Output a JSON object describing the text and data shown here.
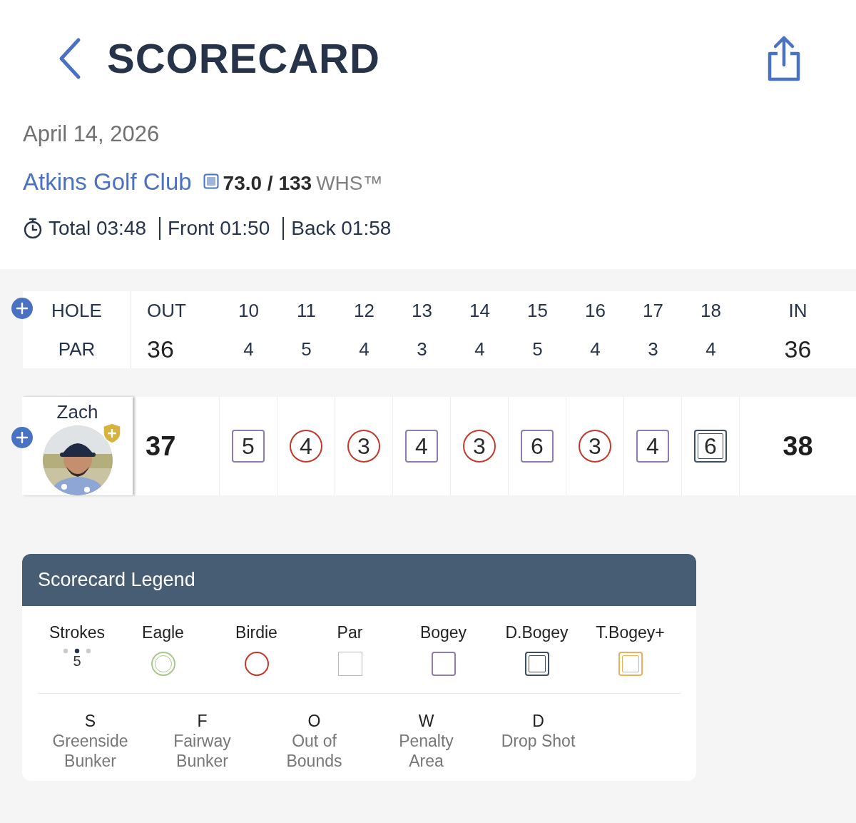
{
  "header": {
    "title": "SCORECARD"
  },
  "round": {
    "date": "April 14, 2026",
    "course": "Atkins Golf Club",
    "rating": "73.0 / 133",
    "system": "WHS™",
    "times": [
      {
        "label": "Total",
        "value": "03:48"
      },
      {
        "label": "Front",
        "value": "01:50"
      },
      {
        "label": "Back",
        "value": "01:58"
      }
    ]
  },
  "holes_row": {
    "label": "HOLE",
    "out": "OUT",
    "holes": [
      "10",
      "11",
      "12",
      "13",
      "14",
      "15",
      "16",
      "17",
      "18"
    ],
    "in": "IN"
  },
  "par_row": {
    "label": "PAR",
    "out": "36",
    "holes": [
      "4",
      "5",
      "4",
      "3",
      "4",
      "5",
      "4",
      "3",
      "4"
    ],
    "in": "36"
  },
  "player": {
    "name": "Zach",
    "out": "37",
    "in": "38",
    "scores": [
      {
        "value": "5",
        "kind": "bogey"
      },
      {
        "value": "4",
        "kind": "birdie"
      },
      {
        "value": "3",
        "kind": "birdie"
      },
      {
        "value": "4",
        "kind": "bogey"
      },
      {
        "value": "3",
        "kind": "birdie"
      },
      {
        "value": "6",
        "kind": "bogey"
      },
      {
        "value": "3",
        "kind": "birdie"
      },
      {
        "value": "4",
        "kind": "bogey"
      },
      {
        "value": "6",
        "kind": "double_bogey"
      }
    ]
  },
  "legend": {
    "title": "Scorecard Legend",
    "strokes": {
      "label": "Strokes",
      "value": "5"
    },
    "marks": [
      {
        "label": "Eagle",
        "kind": "eagle"
      },
      {
        "label": "Birdie",
        "kind": "birdie"
      },
      {
        "label": "Par",
        "kind": "par"
      },
      {
        "label": "Bogey",
        "kind": "bogey"
      },
      {
        "label": "D.Bogey",
        "kind": "double_bogey"
      },
      {
        "label": "T.Bogey+",
        "kind": "triple_bogey"
      }
    ],
    "codes": [
      {
        "letter": "S",
        "meaning": "Greenside Bunker"
      },
      {
        "letter": "F",
        "meaning": "Fairway Bunker"
      },
      {
        "letter": "O",
        "meaning": "Out of Bounds"
      },
      {
        "letter": "W",
        "meaning": "Penalty Area"
      },
      {
        "letter": "D",
        "meaning": "Drop Shot"
      }
    ]
  }
}
